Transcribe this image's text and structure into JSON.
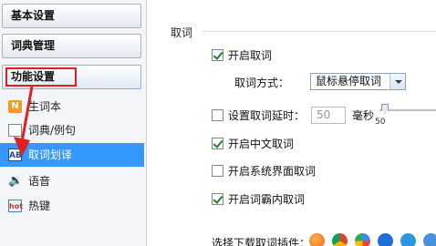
{
  "sidebar": {
    "nav": [
      {
        "label": "基本设置"
      },
      {
        "label": "词典管理"
      },
      {
        "label": "功能设置"
      }
    ],
    "items": [
      {
        "label": "生词本",
        "icon": "notebook-icon"
      },
      {
        "label": "词典/例句",
        "icon": "dictionary-icon"
      },
      {
        "label": "取词划译",
        "icon": "word-capture-icon"
      },
      {
        "label": "语音",
        "icon": "speaker-icon"
      },
      {
        "label": "热键",
        "icon": "hotkey-icon"
      }
    ]
  },
  "main": {
    "section_title": "取词",
    "enable_capture": {
      "label": "开启取词",
      "checked": true
    },
    "capture_mode": {
      "label": "取词方式：",
      "value": "鼠标悬停取词"
    },
    "delay": {
      "label": "设置取词延时：",
      "checked": false,
      "value": "50",
      "unit": "毫秒",
      "slider_min_label": "50"
    },
    "enable_chinese": {
      "label": "开启中文取词",
      "checked": true
    },
    "enable_system_ui": {
      "label": "开启系统界面取词",
      "checked": false
    },
    "enable_inner": {
      "label": "开启词霸内取词",
      "checked": true
    },
    "plugin_label": "选择下载取词插件："
  },
  "colors": {
    "selected_bg": "#3399ff",
    "highlight_red": "#e02020"
  }
}
